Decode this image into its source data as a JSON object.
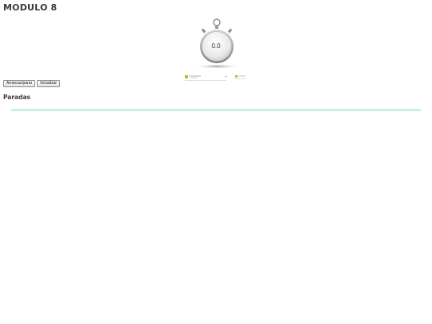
{
  "page": {
    "title": "MODULO 8"
  },
  "stopwatch": {
    "display": "0.0",
    "face_color": "#e6e6e6",
    "accent": "#5b9a2e"
  },
  "controls": {
    "start_stop_label": "Arrancar/parar",
    "reset_label": "Inicializar"
  },
  "laps": {
    "title": "Paradas",
    "bar_color": "#c7f1e1"
  }
}
